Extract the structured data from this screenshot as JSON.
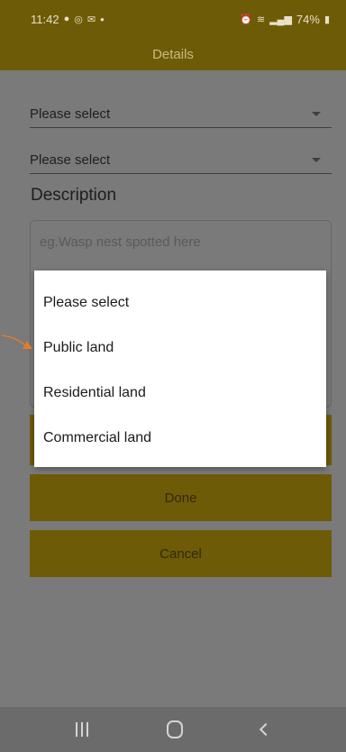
{
  "status_bar": {
    "time": "11:42",
    "left_icons": [
      "facebook-icon",
      "instagram-icon",
      "mail-icon"
    ],
    "dot": "•",
    "battery": "74%"
  },
  "app_bar": {
    "title": "Details"
  },
  "form": {
    "select_1": "Please select",
    "select_2": "Please select",
    "description_label": "Description",
    "description_placeholder": "eg.Wasp nest spotted here"
  },
  "buttons": {
    "done": "Done",
    "cancel": "Cancel"
  },
  "dropdown": {
    "options": [
      "Please select",
      "Public land",
      "Residential land",
      "Commercial land"
    ]
  },
  "colors": {
    "brand": "#6e5b07",
    "arrow": "#e37b2c"
  }
}
